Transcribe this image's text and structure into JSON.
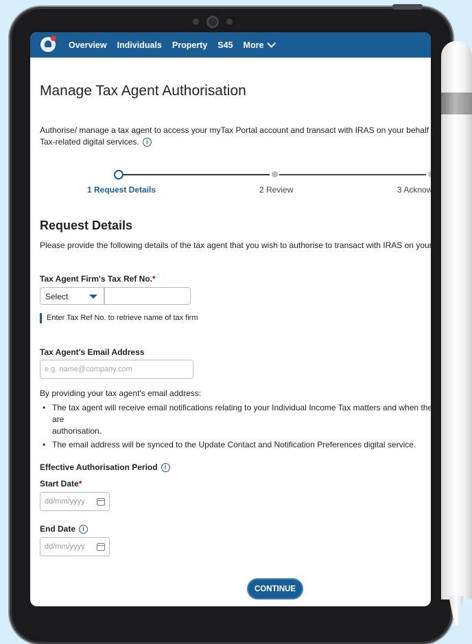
{
  "nav": {
    "items": [
      "Overview",
      "Individuals",
      "Property",
      "S45",
      "More"
    ]
  },
  "page": {
    "title": "Manage Tax Agent Authorisation",
    "intro_line1": "Authorise/ manage a tax agent to access your myTax Portal account and transact with IRAS on your behalf via a suit",
    "intro_line2": "Tax-related digital services."
  },
  "stepper": {
    "steps": [
      "1 Request Details",
      "2 Review",
      "3 Acknow"
    ],
    "active_index": 0
  },
  "request_details": {
    "title": "Request Details",
    "description": "Please provide the following details of the tax agent that you wish to authorise to transact with IRAS on your behalf"
  },
  "tax_ref": {
    "label": "Tax Agent Firm's Tax Ref No.",
    "required_mark": "*",
    "select_value": "Select",
    "input_value": "",
    "hint": "Enter Tax Ref No. to retrieve name of tax firm"
  },
  "email": {
    "label": "Tax Agent's Email Address",
    "placeholder": "e.g. name@company.com",
    "note": "By providing your tax agent's email address:",
    "bullets": [
      "The tax agent will receive email notifications relating to your Individual Income Tax matters and when there are",
      "The email address will be synced to the Update Contact and Notification Preferences digital service."
    ],
    "bullet1_continuation": "authorisation."
  },
  "period": {
    "label": "Effective Authorisation Period",
    "start_label": "Start Date",
    "start_required": "*",
    "start_placeholder": "dd/mm/yyyy",
    "end_label": "End Date",
    "end_placeholder": "dd/mm/yyyy"
  },
  "actions": {
    "continue_label": "CONTINUE"
  },
  "colors": {
    "primary": "#1a5d94",
    "required": "#d0021b",
    "background": "#d7eefc"
  }
}
